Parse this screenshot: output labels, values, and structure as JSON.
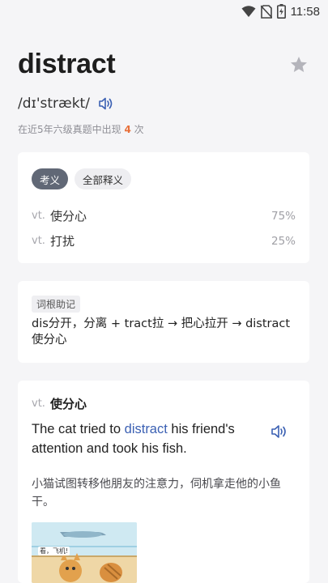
{
  "status_bar": {
    "time": "11:58"
  },
  "word": {
    "title": "distract",
    "phonetic": "/dɪ'strækt/",
    "frequency_prefix": "在近5年六级真题中出现",
    "frequency_count": "4",
    "frequency_suffix": "次"
  },
  "definitions": {
    "tabs": [
      "考义",
      "全部释义"
    ],
    "active_tab": "考义",
    "rows": [
      {
        "pos": "vt.",
        "meaning": "使分心",
        "percent": "75%"
      },
      {
        "pos": "vt.",
        "meaning": "打扰",
        "percent": "25%"
      }
    ]
  },
  "mnemonic": {
    "label": "词根助记",
    "text": "dis分开，分离 + tract拉 → 把心拉开 → distract 使分心"
  },
  "example": {
    "pos": "vt.",
    "meaning": "使分心",
    "sentence_before": "The cat tried to ",
    "sentence_highlight": "distract",
    "sentence_after": " his friend's attention and took his fish.",
    "translation": "小猫试图转移他朋友的注意力，伺机拿走他的小鱼干。",
    "image_caption": "看，飞机!"
  },
  "colors": {
    "accent": "#3b60b3",
    "count_highlight": "#e8703a",
    "active_tab_bg": "#616876"
  },
  "icons": [
    "wifi-icon",
    "no-sim-icon",
    "battery-icon",
    "star-icon",
    "speaker-icon"
  ]
}
